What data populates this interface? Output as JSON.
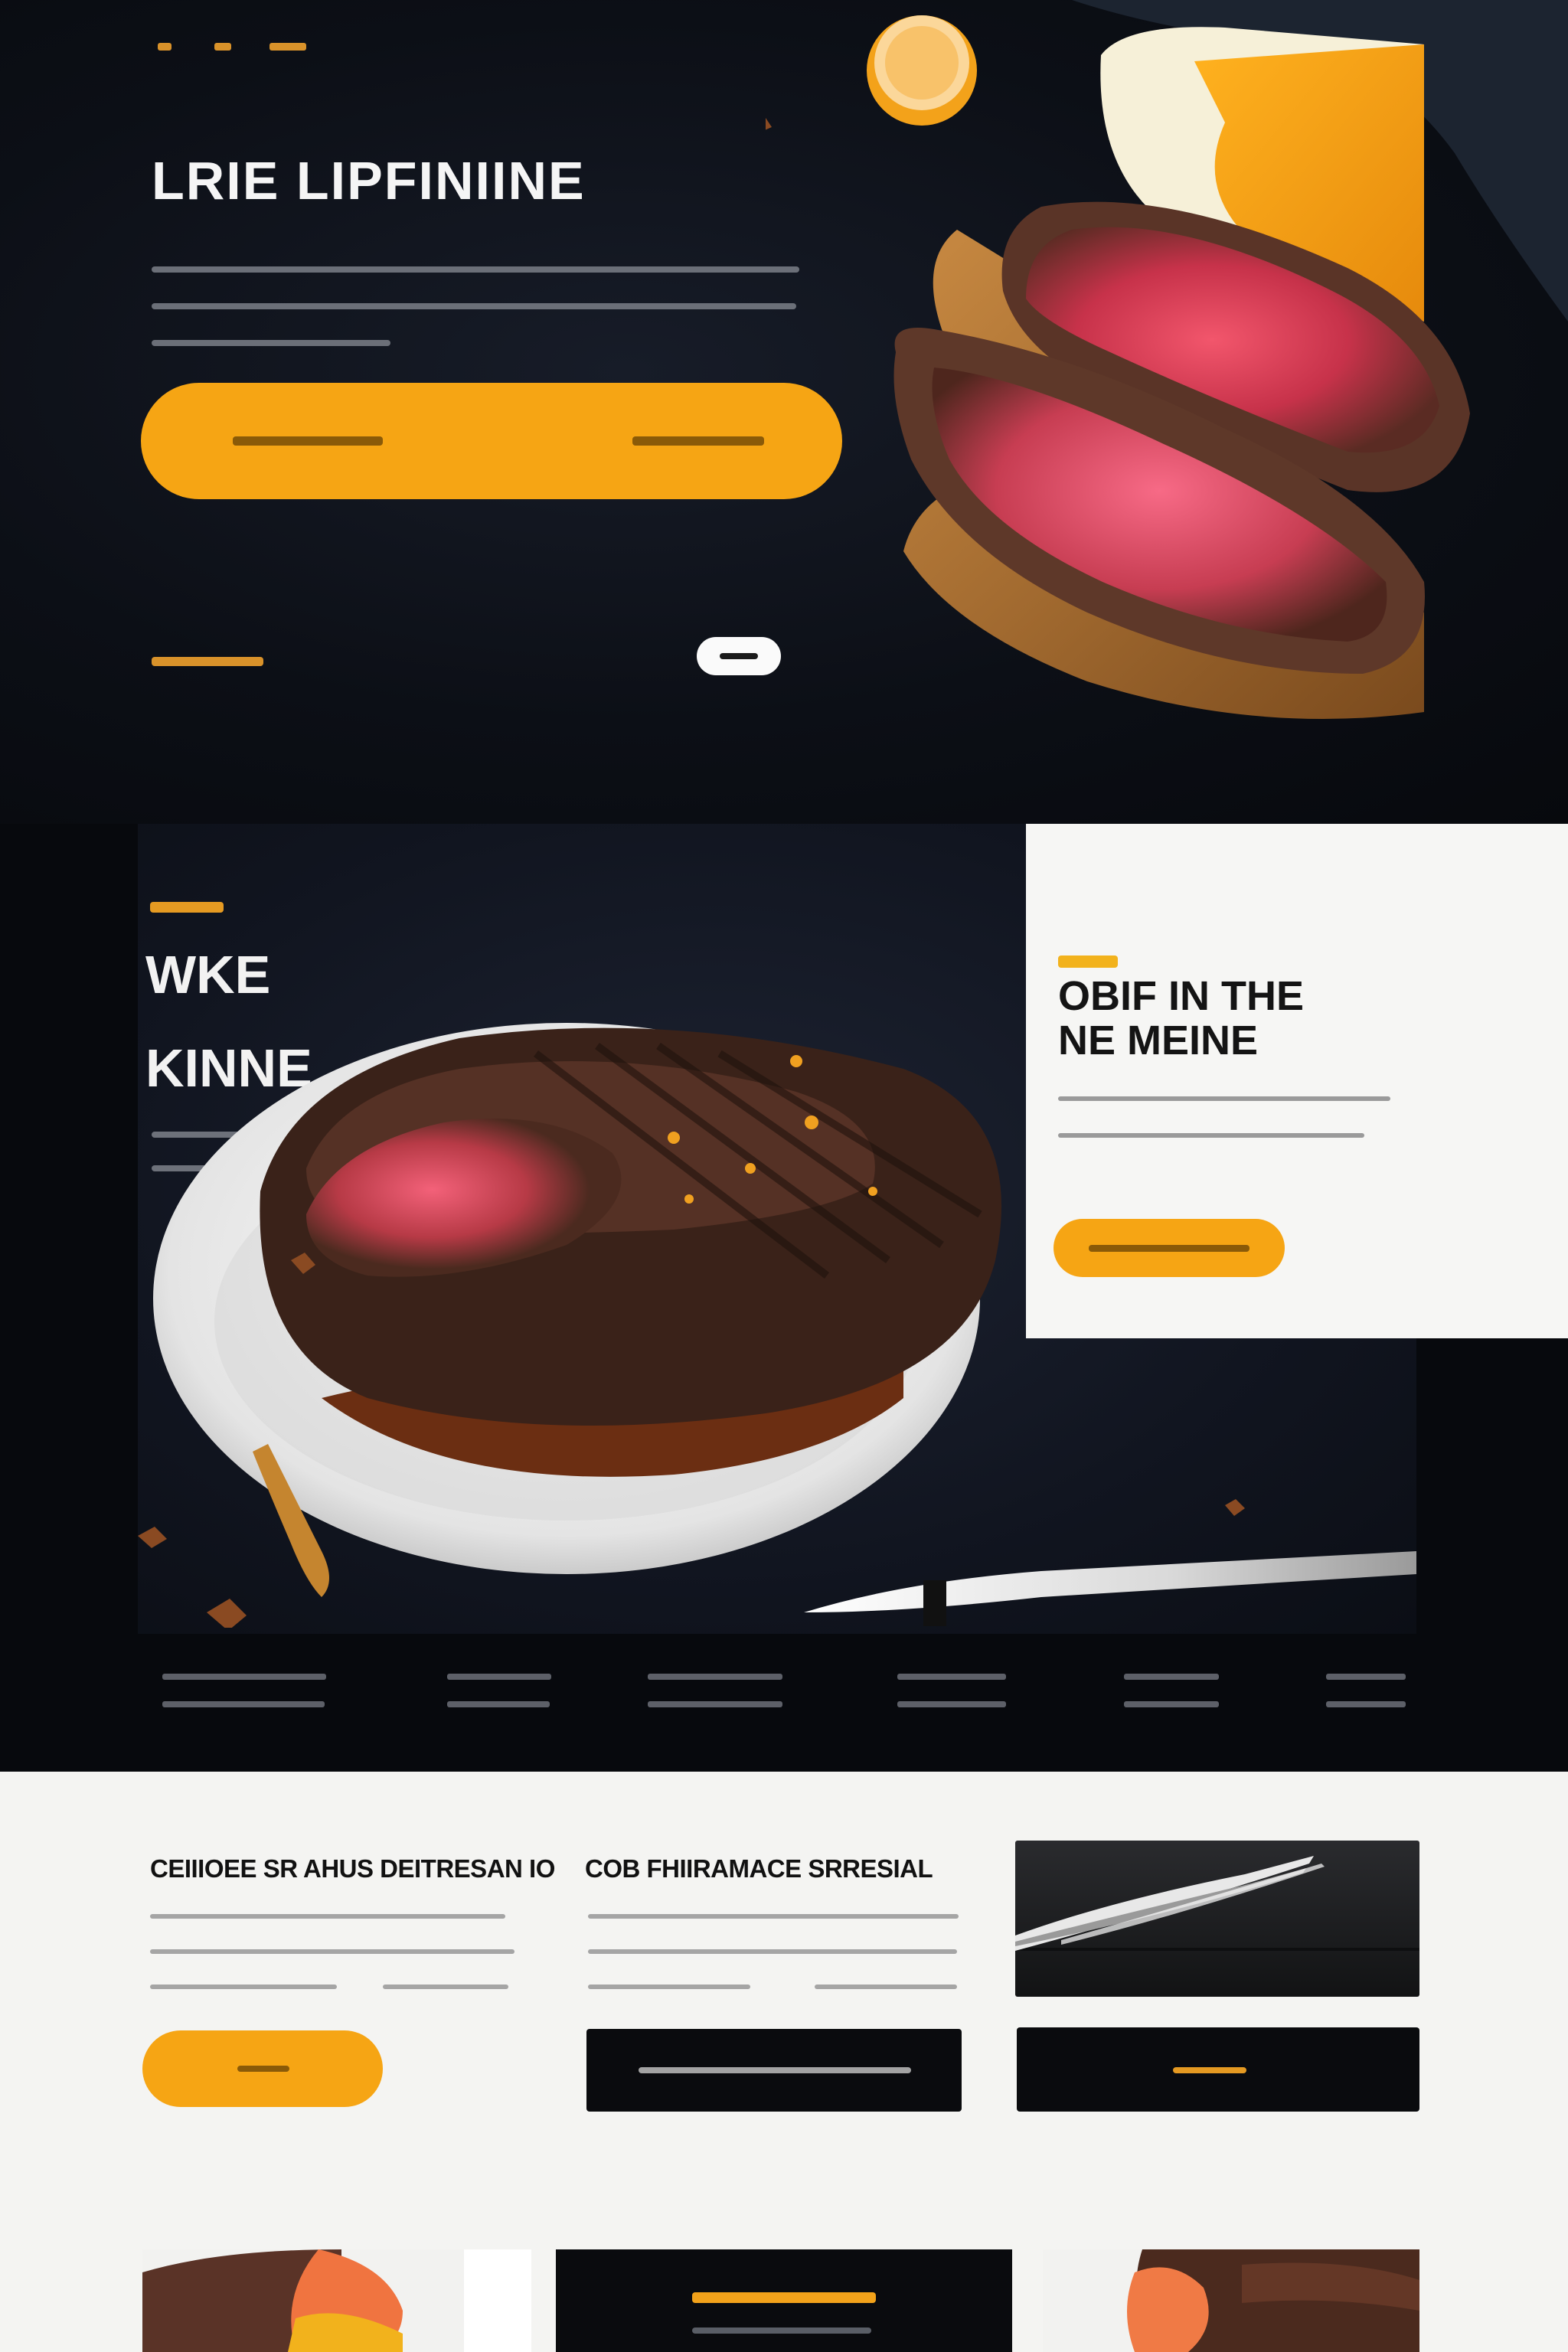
{
  "hero": {
    "title": "LRIE LIPFINIINE"
  },
  "feature": {
    "title_line1": "WKE",
    "title_line2": "KINNE"
  },
  "info_card": {
    "title_line1": "OBIF IN THE",
    "title_line2": "NE MEINE"
  },
  "cards": {
    "card1_title": "CEIIIOEE SR AHUS DEITRESAN IO",
    "card2_title": "COB FHIIRAMACE SRRESIAL"
  },
  "colors": {
    "accent": "#f6a514",
    "dark_bg": "#0b0e15",
    "light_bg": "#f4f4f2",
    "orange_label": "#e59a22"
  }
}
